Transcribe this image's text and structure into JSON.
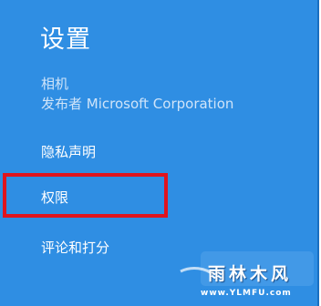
{
  "settings": {
    "title": "设置",
    "app_name": "相机",
    "publisher": "发布者 Microsoft Corporation",
    "items": [
      {
        "label": "隐私声明"
      },
      {
        "label": "权限"
      },
      {
        "label": "评论和打分"
      }
    ]
  },
  "watermark": {
    "text": "雨林木风",
    "url": "www.YLMFU.com"
  },
  "colors": {
    "pane_background": "#2f8ee3",
    "highlight_border": "#e0141e",
    "text": "#ffffff"
  }
}
